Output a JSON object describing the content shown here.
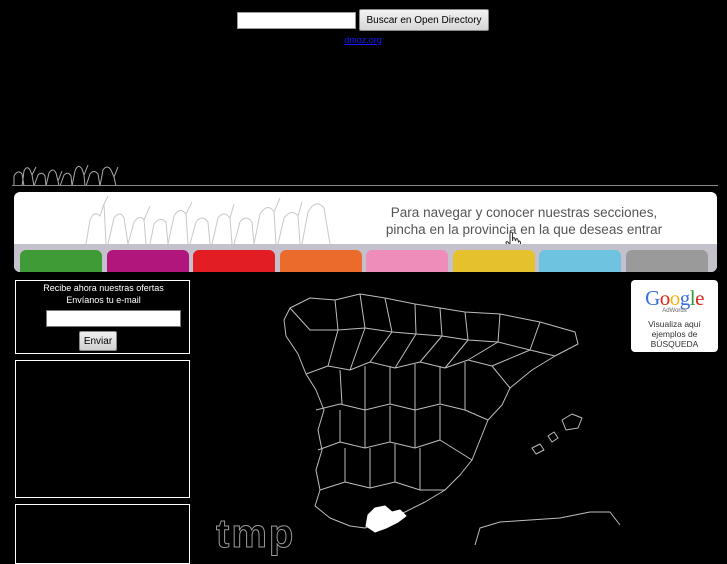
{
  "search": {
    "input_value": "",
    "button_label": "Buscar en Open Directory",
    "link_text": "dmoz.org"
  },
  "banner": {
    "line1": "Para navegar y conocer nuestras secciones,",
    "line2": "pincha en la provincia en la que deseas entrar",
    "tab_colors": [
      "#3f9b35",
      "#b0167c",
      "#e21d24",
      "#ea6b2b",
      "#ee8dba",
      "#e4c12d",
      "#6ec4e0",
      "#9a9a9a"
    ]
  },
  "newsletter": {
    "title": "Recibe ahora nuestras ofertas",
    "subtitle": "Envíanos tu e-mail",
    "email_value": "",
    "button_label": "Enviar"
  },
  "adwords": {
    "logo": "Google",
    "sub": "AdWords",
    "line1": "Visualiza aquí",
    "line2": "ejemplos de",
    "line3": "BÚSQUEDA"
  },
  "map": {
    "watermark": "tmp",
    "highlighted_province": "Málaga"
  }
}
